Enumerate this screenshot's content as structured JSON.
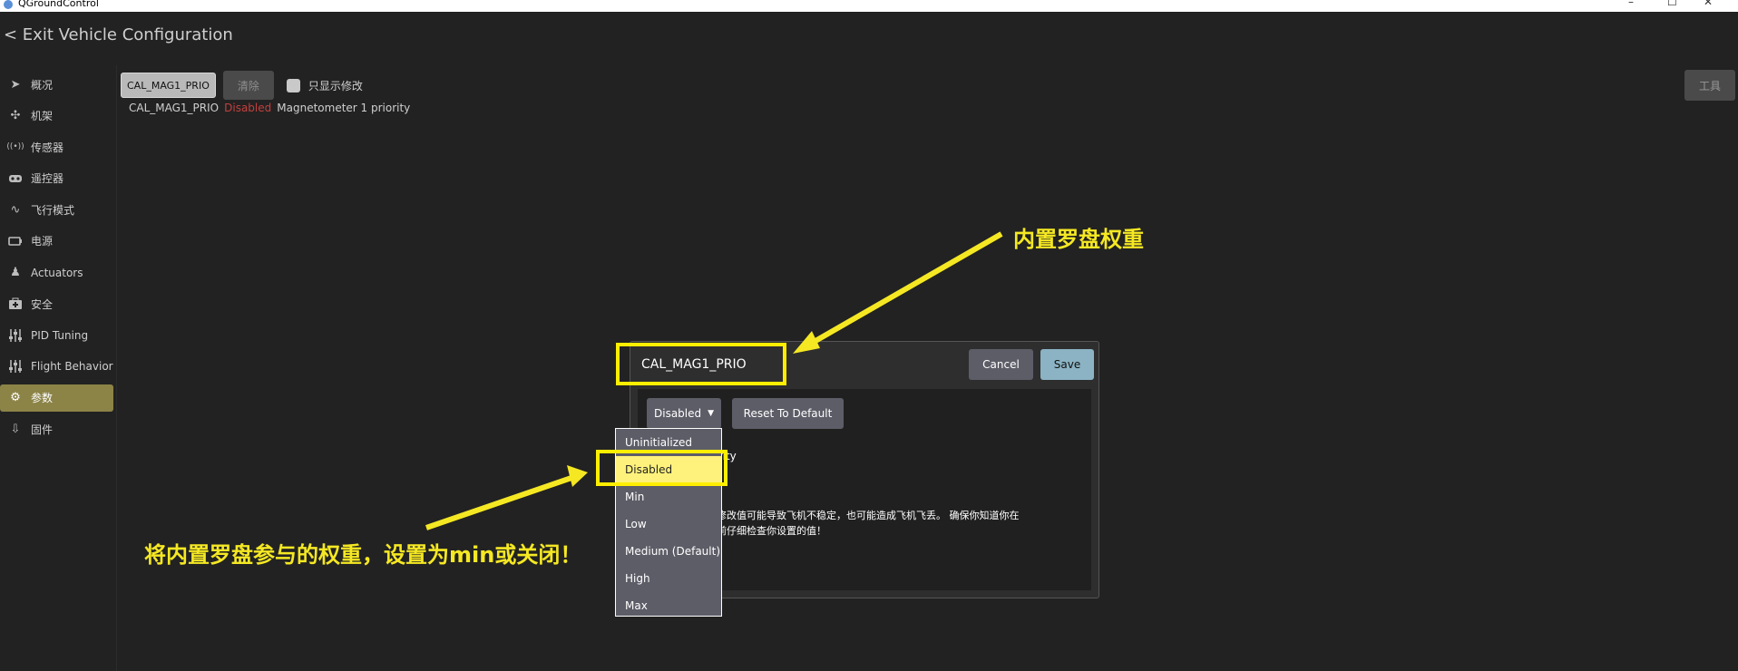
{
  "window": {
    "title": "QGroundControl",
    "controls": [
      "–",
      "☐",
      "✕"
    ]
  },
  "header": {
    "back_label": "< Exit Vehicle Configuration"
  },
  "sidebar": {
    "items": [
      {
        "label": "概况",
        "icon": "paper-plane-icon",
        "glyph": "➤"
      },
      {
        "label": "机架",
        "icon": "airframe-icon",
        "glyph": "✣"
      },
      {
        "label": "传感器",
        "icon": "radio-waves-icon",
        "glyph": "((•))"
      },
      {
        "label": "遥控器",
        "icon": "gamepad-icon",
        "glyph": "🎮"
      },
      {
        "label": "飞行模式",
        "icon": "wave-icon",
        "glyph": "∿"
      },
      {
        "label": "电源",
        "icon": "battery-icon",
        "glyph": "▭"
      },
      {
        "label": "Actuators",
        "icon": "actuator-icon",
        "glyph": "♟"
      },
      {
        "label": "安全",
        "icon": "medkit-icon",
        "glyph": "✚"
      },
      {
        "label": "PID Tuning",
        "icon": "sliders-icon",
        "glyph": "⫶"
      },
      {
        "label": "Flight Behavior",
        "icon": "sliders-icon",
        "glyph": "⫶"
      },
      {
        "label": "参数",
        "icon": "gears-icon",
        "glyph": "⚙",
        "active": true
      },
      {
        "label": "固件",
        "icon": "download-icon",
        "glyph": "⇩"
      }
    ]
  },
  "toolbar": {
    "search_value": "CAL_MAG1_PRIO",
    "clear_label": "清除",
    "show_modified_label": "只显示修改",
    "tools_label": "工具"
  },
  "param_row": {
    "name": "CAL_MAG1_PRIO",
    "value": "Disabled",
    "description": "Magnetometer 1 priority"
  },
  "dialog": {
    "title": "CAL_MAG1_PRIO",
    "cancel_label": "Cancel",
    "save_label": "Save",
    "selected_value": "Disabled",
    "reset_label": "Reset To Default",
    "description": "1 priority",
    "warning": "飞行时修改值可能导致飞机不稳定，也可能造成飞机飞丢。 确保你知道你在\n保存之前仔细检查你设置的值！"
  },
  "dropdown": {
    "options": [
      "Uninitialized",
      "Disabled",
      "Min",
      "Low",
      "Medium (Default)",
      "High",
      "Max"
    ],
    "selected_index": 1
  },
  "annotations": {
    "top": "内置罗盘权重",
    "bottom": "将内置罗盘参与的权重，设置为min或关闭！",
    "color": "#f5e823"
  }
}
